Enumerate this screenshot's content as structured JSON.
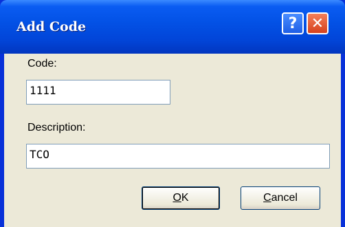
{
  "window": {
    "title": "Add Code",
    "help_glyph": "?",
    "close_glyph": "✕"
  },
  "form": {
    "code_label": "Code:",
    "code_value": "1111",
    "description_label": "Description:",
    "description_value": "TCO"
  },
  "buttons": {
    "ok_mnemonic": "O",
    "ok_rest": "K",
    "cancel_mnemonic": "C",
    "cancel_rest": "ancel"
  }
}
